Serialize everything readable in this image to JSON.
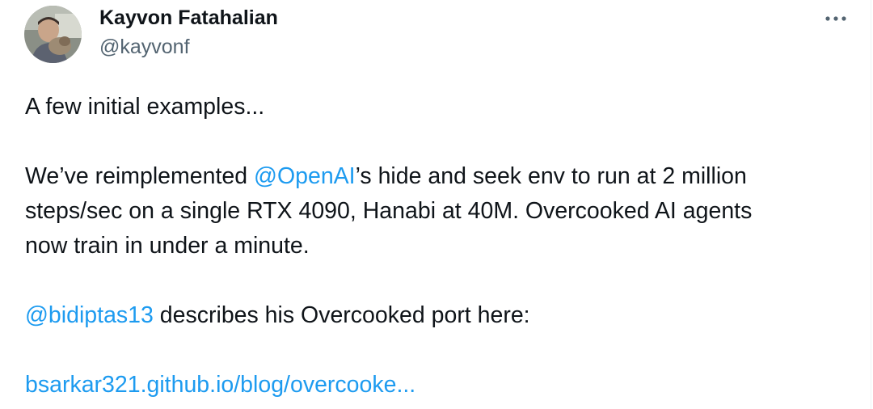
{
  "author": {
    "name": "Kayvon Fatahalian",
    "handle": "@kayvonf"
  },
  "menu": {
    "icon": "more-horizontal-icon"
  },
  "tweet": {
    "line1": "A few initial examples...",
    "p2": {
      "mention": "@OpenAI",
      "after_mention": "’s hide and seek env to run at 2 million",
      "before_mention": "We’ve reimplemented ",
      "line2": "steps/sec on a single RTX 4090, Hanabi at 40M. Overcooked AI agents",
      "line3": "now train in under a minute."
    },
    "p3": {
      "mention": "@bidiptas13",
      "rest": " describes his Overcooked port here:"
    },
    "link": "bsarkar321.github.io/blog/overcooke..."
  },
  "colors": {
    "link": "#1d9bf0",
    "handle": "#536471",
    "text": "#0f1419"
  }
}
